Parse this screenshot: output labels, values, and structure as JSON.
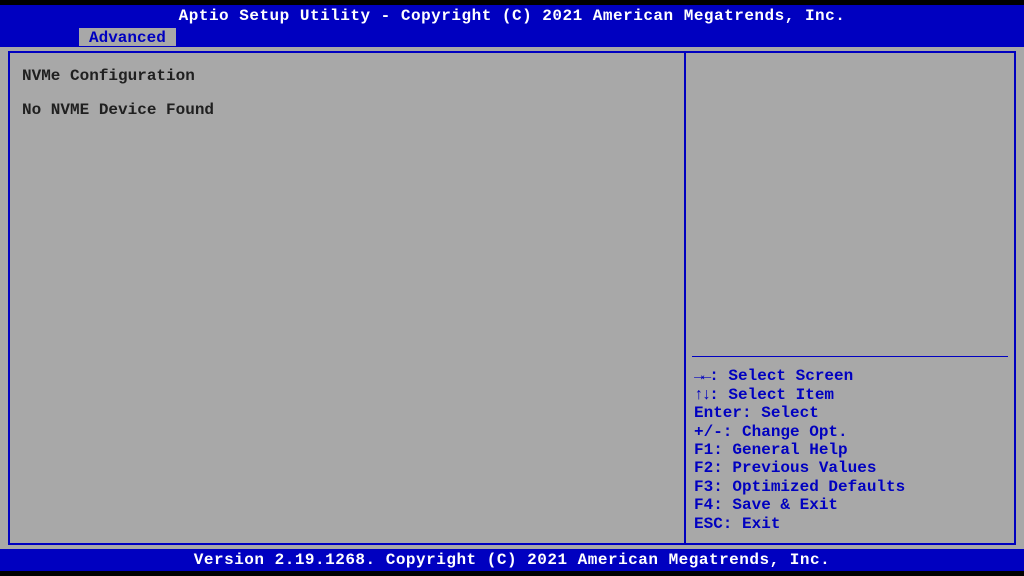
{
  "title": "Aptio Setup Utility - Copyright (C) 2021 American Megatrends, Inc.",
  "tab": {
    "label": "Advanced"
  },
  "left": {
    "heading": "NVMe Configuration",
    "status": "No NVME Device Found"
  },
  "help": {
    "select_screen": {
      "keys": "→←",
      "label": ": Select Screen"
    },
    "select_item": {
      "keys": "↑↓",
      "label": ": Select Item"
    },
    "enter": "Enter: Select",
    "change": "+/-: Change Opt.",
    "f1": "F1: General Help",
    "f2": "F2: Previous Values",
    "f3": "F3: Optimized Defaults",
    "f4": "F4: Save & Exit",
    "esc": "ESC: Exit"
  },
  "version": "Version 2.19.1268. Copyright (C) 2021 American Megatrends, Inc."
}
